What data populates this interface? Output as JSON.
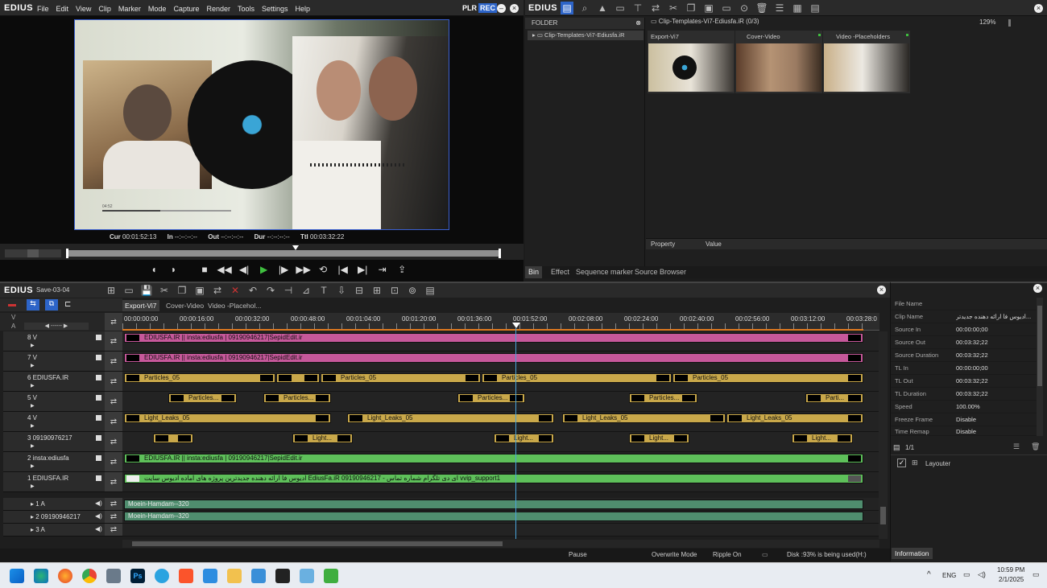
{
  "player": {
    "logo": "EDIUS",
    "menu": [
      "File",
      "Edit",
      "View",
      "Clip",
      "Marker",
      "Mode",
      "Capture",
      "Render",
      "Tools",
      "Settings",
      "Help"
    ],
    "plr": "PLR",
    "rec": "REC",
    "timecodes": {
      "cur_label": "Cur",
      "cur": "00:01:52:13",
      "in_label": "In",
      "in": "--:--:--:--",
      "out_label": "Out",
      "out": "--:--:--:--",
      "dur_label": "Dur",
      "dur": "--:--:--:--",
      "ttl_label": "Ttl",
      "ttl": "00:03:32:22"
    },
    "overlay_time": "04:52"
  },
  "bin": {
    "logo": "EDIUS",
    "folder_header": "FOLDER",
    "folder_item": "Clip-Templates-Vi7-Ediusfa.iR",
    "path": "Clip-Templates-Vi7-Ediusfa.iR (0/3)",
    "zoom": "129%",
    "clips": [
      {
        "name": "Export-Vi7"
      },
      {
        "name": "Cover-Video"
      },
      {
        "name": "Video -Placeholders"
      }
    ],
    "prop_header": "Property",
    "value_header": "Value",
    "tabs": [
      "Bin",
      "Effect",
      "Sequence marker",
      "Source Browser"
    ]
  },
  "timeline": {
    "logo": "EDIUS",
    "sequence": "Save-03-04",
    "seq_tabs": [
      "Export-Vi7",
      "Cover-Video",
      "Video -Placehol..."
    ],
    "ruler": [
      "00:00:00:00",
      "00:00:16:00",
      "00:00:32:00",
      "00:00:48:00",
      "00:01:04:00",
      "00:01:20:00",
      "00:01:36:00",
      "00:01:52:00",
      "00:02:08:00",
      "00:02:24:00",
      "00:02:40:00",
      "00:02:56:00",
      "00:03:12:00",
      "00:03:28:0"
    ],
    "tracks": [
      {
        "label": "8 V"
      },
      {
        "label": "7 V"
      },
      {
        "label": "6 EDIUSFA.IR"
      },
      {
        "label": "5 V"
      },
      {
        "label": "4 V"
      },
      {
        "label": "3 09190976217"
      },
      {
        "label": "2 insta:ediusfa"
      },
      {
        "label": "1 EDIUSFA.IR"
      }
    ],
    "audio_tracks": [
      {
        "label": "1 A"
      },
      {
        "label": "2 09190946217"
      },
      {
        "label": "3 A"
      }
    ],
    "clip_text": {
      "t8": "EDIUSFA.IR || insta:ediusfa |  09190946217|SepidEdit.ir",
      "t7": "EDIUSFA.IR || insta:ediusfa |  09190946217|SepidEdit.ir",
      "particles": "Particles_05",
      "particles_short": "Particles...",
      "particles_shorter": "Parti...",
      "light": "Light_Leaks_05",
      "light_short": "Light...",
      "t2": "EDIUSFA.IR || insta:ediusfa |  09190946217|SepidEdit.ir",
      "t1": "اُدیوس فا ارائه دهنده جدیدترین پروژه های آماده ادیوس سایت  EdiusFa.iR    09190946217  - ای دی تلگرام   شماره تماس   vvip_support1",
      "audio": "Moein-Hamdam--320"
    },
    "status": {
      "state": "Pause",
      "mode": "Overwrite Mode",
      "ripple": "Ripple On",
      "disk": "Disk :93% is being used(H:)"
    }
  },
  "info": {
    "rows": [
      {
        "k": "File Name",
        "v": ""
      },
      {
        "k": "Clip Name",
        "v": "ادیوس فا ارائه دهنده جدیدتر..."
      },
      {
        "k": "Source In",
        "v": "00:00:00;00"
      },
      {
        "k": "Source Out",
        "v": "00:03:32;22"
      },
      {
        "k": "Source Duration",
        "v": "00:03:32;22"
      },
      {
        "k": "TL In",
        "v": "00:00:00;00"
      },
      {
        "k": "TL Out",
        "v": "00:03:32;22"
      },
      {
        "k": "TL Duration",
        "v": "00:03:32;22"
      },
      {
        "k": "Speed",
        "v": "100.00%"
      },
      {
        "k": "Freeze Frame",
        "v": "Disable"
      },
      {
        "k": "Time Remap",
        "v": "Disable"
      }
    ],
    "count": "1/1",
    "layouter": "Layouter",
    "tab": "Information"
  },
  "taskbar": {
    "lang": "ENG",
    "time": "10:59 PM",
    "date": "2/1/2025"
  }
}
